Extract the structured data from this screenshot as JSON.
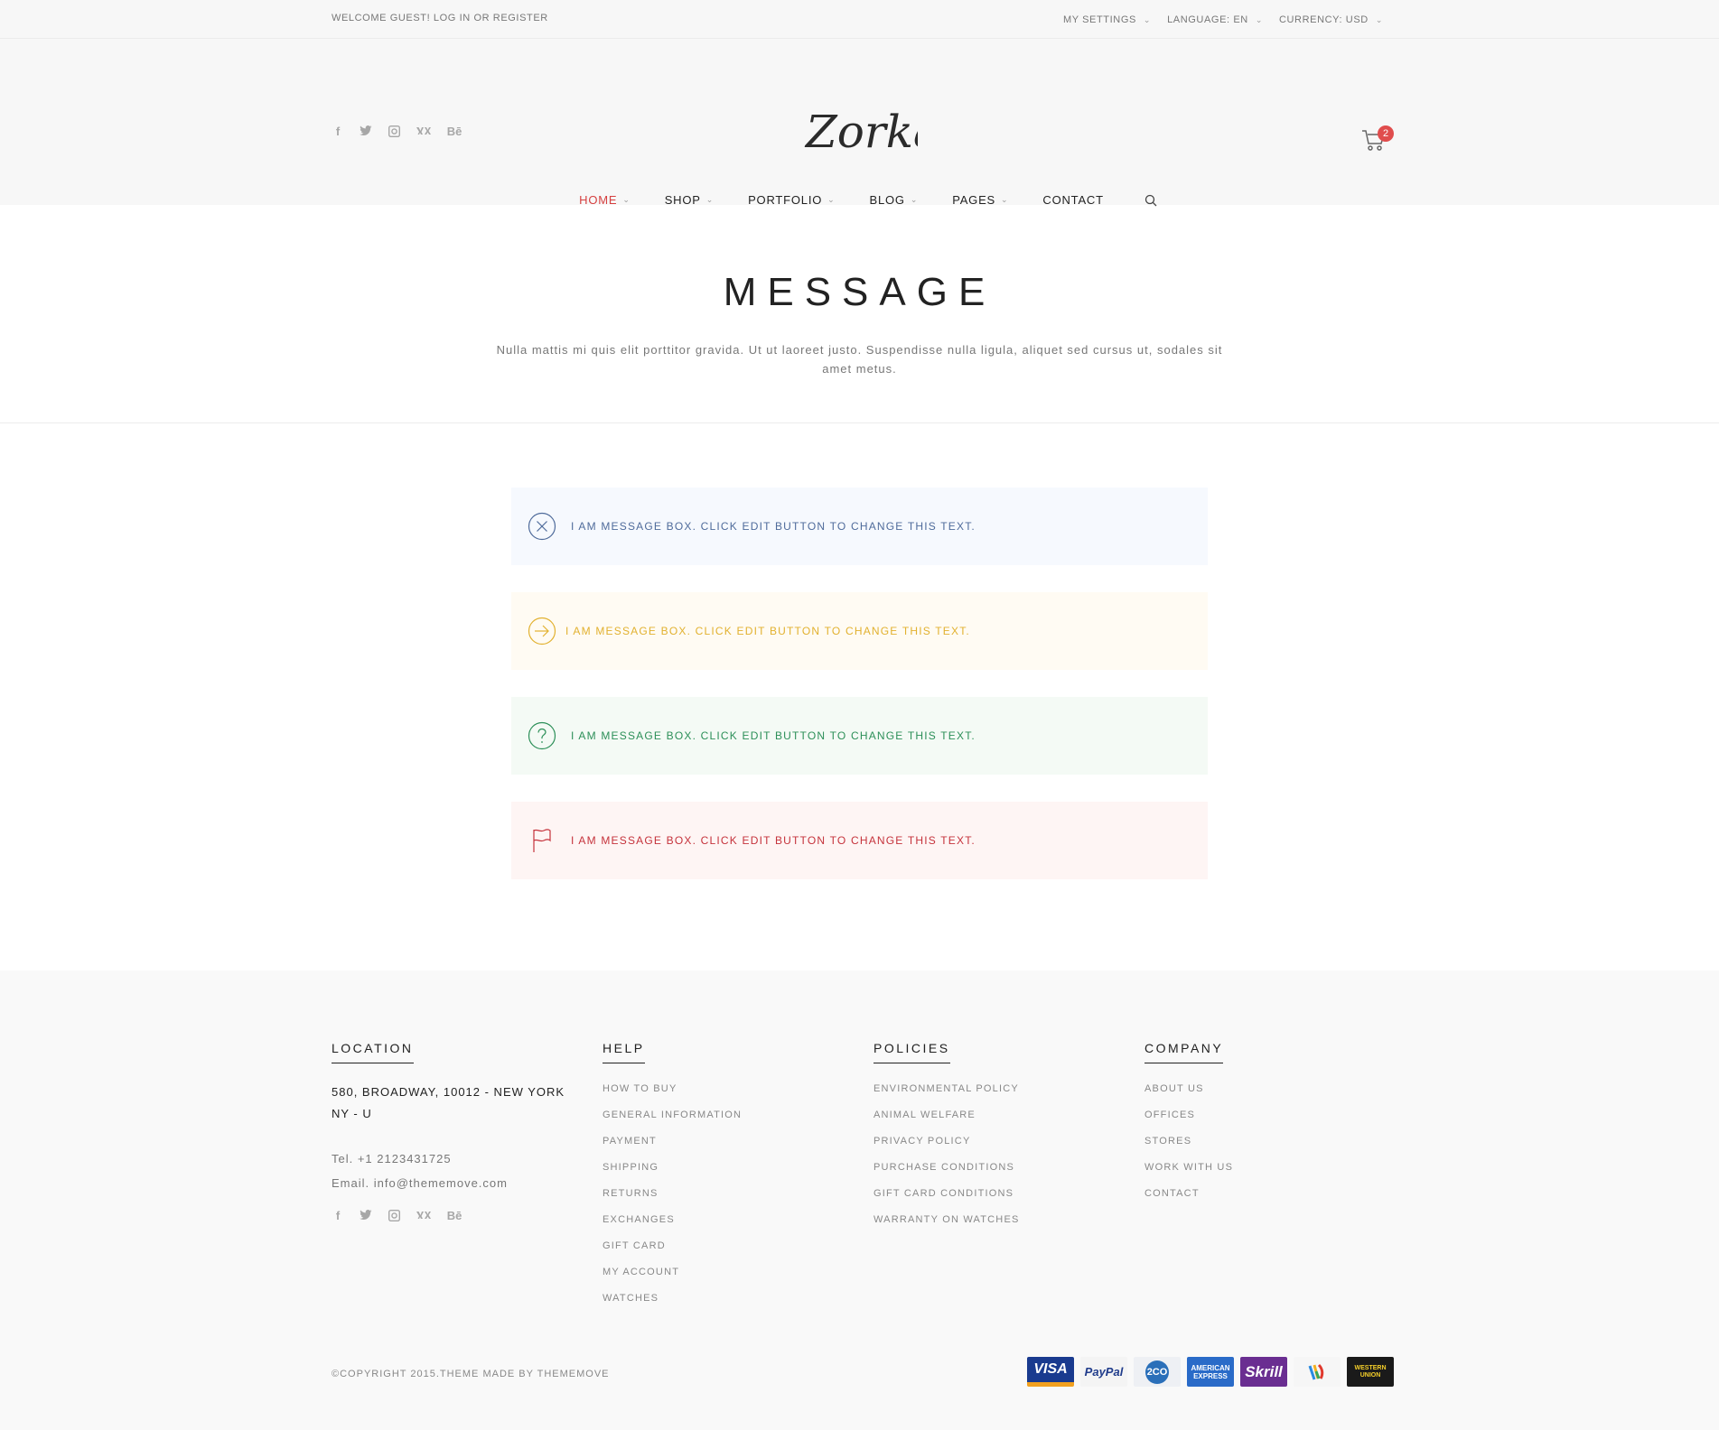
{
  "topbar": {
    "welcome": "WELCOME GUEST! LOG IN OR REGISTER",
    "settings": "MY SETTINGS",
    "language": "LANGUAGE: EN",
    "currency": "CURRENCY: USD"
  },
  "header": {
    "logo_text": "Zorka",
    "cart_count": "2",
    "social_icons": [
      "facebook-icon",
      "twitter-icon",
      "instagram-icon",
      "vk-icon",
      "behance-icon"
    ]
  },
  "nav": {
    "items": [
      {
        "label": "HOME",
        "dropdown": true,
        "active": true
      },
      {
        "label": "SHOP",
        "dropdown": true
      },
      {
        "label": "PORTFOLIO",
        "dropdown": true
      },
      {
        "label": "BLOG",
        "dropdown": true
      },
      {
        "label": "PAGES",
        "dropdown": true
      },
      {
        "label": "CONTACT",
        "dropdown": false
      }
    ]
  },
  "page": {
    "title": "MESSAGE",
    "subtitle": "Nulla mattis mi quis elit porttitor gravida. Ut ut laoreet justo. Suspendisse nulla ligula, aliquet sed cursus ut, sodales sit amet metus."
  },
  "messages": [
    {
      "type": "info",
      "icon": "close-circle-icon",
      "text": "I AM MESSAGE BOX. CLICK EDIT BUTTON TO CHANGE THIS TEXT."
    },
    {
      "type": "warning",
      "icon": "arrow-right-circle-icon",
      "text": "I AM MESSAGE BOX. CLICK EDIT BUTTON TO CHANGE THIS TEXT."
    },
    {
      "type": "success",
      "icon": "question-circle-icon",
      "text": "I AM MESSAGE BOX. CLICK EDIT BUTTON TO CHANGE THIS TEXT."
    },
    {
      "type": "error",
      "icon": "flag-icon",
      "text": "I AM MESSAGE BOX. CLICK EDIT BUTTON TO CHANGE THIS TEXT."
    }
  ],
  "footer": {
    "location": {
      "heading": "LOCATION",
      "address": "580, BROADWAY, 10012 - NEW YORK NY - U",
      "tel": "Tel. +1 2123431725",
      "email": "Email. info@thememove.com"
    },
    "help": {
      "heading": "HELP",
      "items": [
        "HOW TO BUY",
        "GENERAL INFORMATION",
        "PAYMENT",
        "SHIPPING",
        "RETURNS",
        "EXCHANGES",
        "GIFT CARD",
        "MY ACCOUNT",
        "WATCHES"
      ]
    },
    "policies": {
      "heading": "POLICIES",
      "items": [
        "ENVIRONMENTAL POLICY",
        "ANIMAL WELFARE",
        "PRIVACY POLICY",
        "PURCHASE CONDITIONS",
        "GIFT CARD CONDITIONS",
        "WARRANTY ON WATCHES"
      ]
    },
    "company": {
      "heading": "COMPANY",
      "items": [
        "ABOUT US",
        "OFFICES",
        "STORES",
        "WORK WITH US",
        "CONTACT"
      ]
    },
    "copyright": "©COPYRIGHT 2015.THEME MADE BY THEMEMOVE",
    "payments": {
      "visa": "VISA",
      "paypal": "PayPal",
      "twoco": "2CO",
      "amex": "AMERICAN EXPRESS",
      "skrill": "Skrill",
      "wu": "WESTERN UNION"
    }
  },
  "colors": {
    "accent": "#d53f3f",
    "info": "#4f6b9b",
    "warning": "#e2b12f",
    "success": "#2c8f58",
    "error": "#c5323b"
  }
}
